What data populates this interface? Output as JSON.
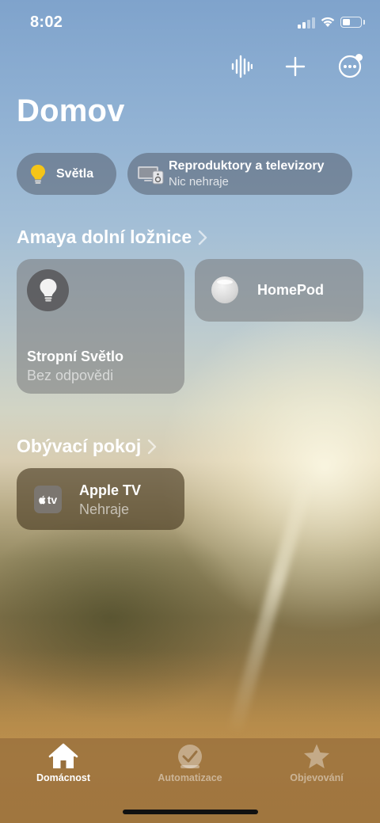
{
  "status_bar": {
    "time": "8:02"
  },
  "toolbar": {
    "voice_icon": "waveform-icon",
    "add_icon": "plus-icon",
    "more_icon": "ellipsis-circle-icon"
  },
  "page": {
    "title": "Domov"
  },
  "chips": {
    "lights": {
      "title": "Světla",
      "icon": "bulb-icon"
    },
    "speakers": {
      "title": "Reproduktory a televizory",
      "subtitle": "Nic nehraje",
      "icon": "speaker-tv-icon"
    }
  },
  "rooms": [
    {
      "name": "Amaya dolní ložnice",
      "accessories": [
        {
          "name": "Stropní Světlo",
          "status": "Bez odpovědi",
          "icon": "bulb-icon"
        },
        {
          "name": "HomePod",
          "icon": "homepod-icon"
        }
      ]
    },
    {
      "name": "Obývací pokoj",
      "accessories": [
        {
          "name": "Apple TV",
          "status": "Nehraje",
          "icon": "appletv-icon",
          "badge": "tv"
        }
      ]
    }
  ],
  "tab_bar": {
    "tabs": [
      {
        "label": "Domácnost",
        "icon": "house-icon",
        "active": true
      },
      {
        "label": "Automatizace",
        "icon": "clock-check-icon",
        "active": false
      },
      {
        "label": "Objevování",
        "icon": "star-icon",
        "active": false
      }
    ]
  }
}
